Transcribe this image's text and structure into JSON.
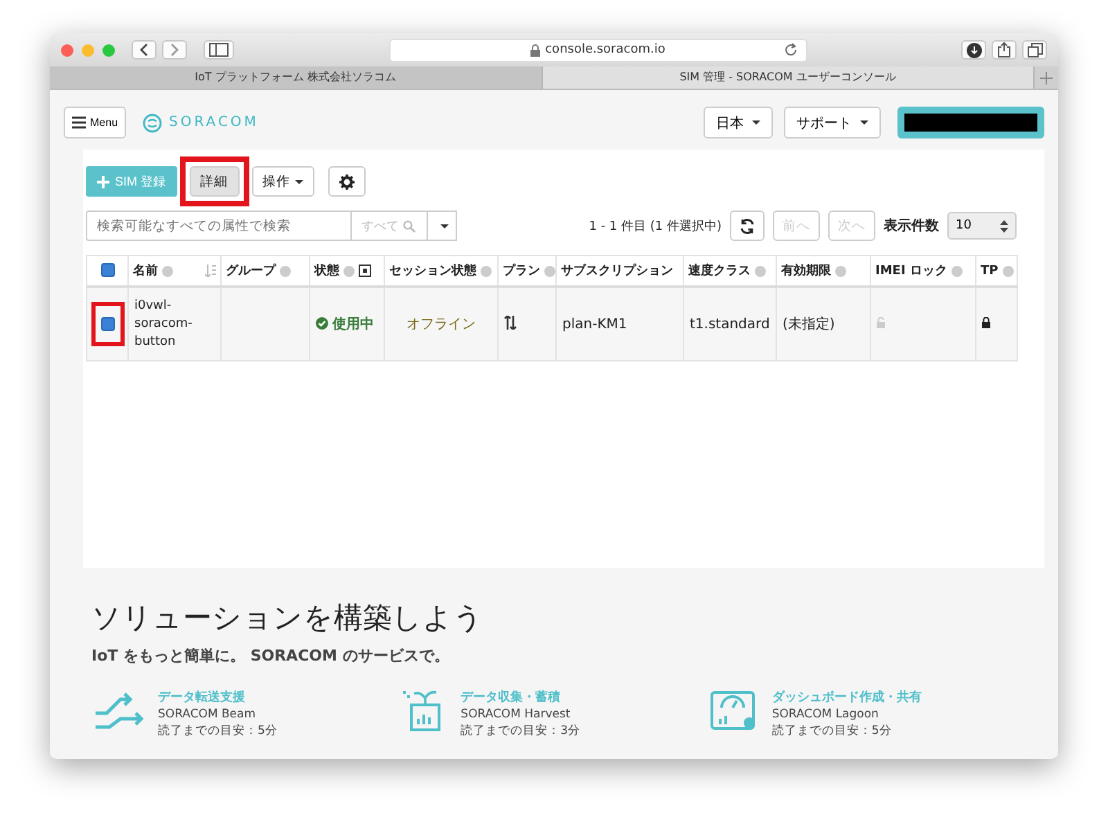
{
  "browser": {
    "url": "console.soracom.io",
    "tabs": [
      {
        "title": "IoT プラットフォーム 株式会社ソラコム",
        "selected": false
      },
      {
        "title": "SIM 管理 - SORACOM ユーザーコンソール",
        "selected": true
      }
    ]
  },
  "header": {
    "menu_button": "Menu",
    "logo": "SORACOM",
    "language": "日本",
    "support": "サポート"
  },
  "toolbar": {
    "register": "SIM 登録",
    "details": {
      "label": "詳細",
      "highlighted": true
    },
    "actions": "操作"
  },
  "search": {
    "placeholder": "検索可能なすべての属性で検索",
    "filter": "すべて"
  },
  "pagination": {
    "summary": "1 - 1 件目 (1 件選択中)",
    "prev": "前へ",
    "next": "次へ",
    "page_size_label": "表示件数",
    "page_size": "10"
  },
  "table": {
    "header_checked": true,
    "columns": [
      {
        "label": "名前",
        "help": true,
        "kind": "sort"
      },
      {
        "label": "グループ",
        "help": true,
        "kind": "plain"
      },
      {
        "label": "状態",
        "help": true,
        "kind": "filter"
      },
      {
        "label": "セッション状態",
        "help": true,
        "kind": "plain"
      },
      {
        "label": "プラン",
        "help": true,
        "kind": "plain"
      },
      {
        "label": "サブスクリプション",
        "help": false,
        "kind": "plain"
      },
      {
        "label": "速度クラス",
        "help": true,
        "kind": "plain"
      },
      {
        "label": "有効期限",
        "help": true,
        "kind": "plain"
      },
      {
        "label": "IMEI ロック",
        "help": true,
        "kind": "plain"
      },
      {
        "label": "TP",
        "help": true,
        "kind": "plain"
      }
    ],
    "rows": [
      {
        "checked": true,
        "highlighted": true,
        "name": "i0vwl-soracom-button",
        "status": "使用中",
        "session": "オフライン",
        "subscription": "plan-KM1",
        "speed_class": "t1.standard",
        "expiry": "(未指定)",
        "imei_locked": false,
        "tp_locked": true
      }
    ]
  },
  "solutions": {
    "title": "ソリューションを構築しよう",
    "subtitle": "IoT をもっと簡単に。 SORACOM のサービスで。",
    "cards": [
      {
        "kind": "transfer",
        "title": "データ転送支援",
        "product": "SORACOM Beam",
        "time": "読了までの目安：5分"
      },
      {
        "kind": "harvest",
        "title": "データ収集・蓄積",
        "product": "SORACOM Harvest",
        "time": "読了までの目安：3分"
      },
      {
        "kind": "dashboard",
        "title": "ダッシュボード作成・共有",
        "product": "SORACOM Lagoon",
        "time": "読了までの目安：5分"
      }
    ]
  }
}
